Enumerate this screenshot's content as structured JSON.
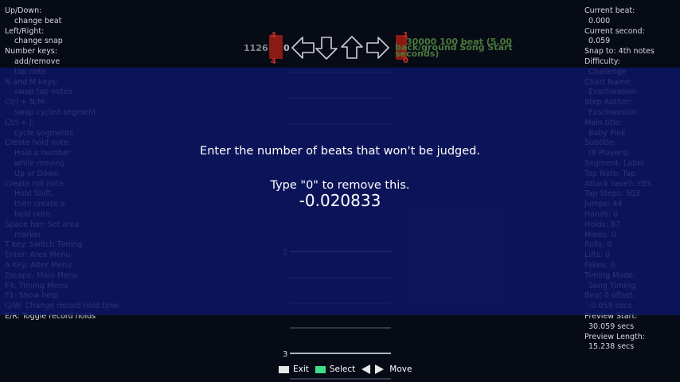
{
  "help": [
    {
      "text": "Up/Down:",
      "indent": false
    },
    {
      "text": "change beat",
      "indent": true
    },
    {
      "text": "Left/Right:",
      "indent": false
    },
    {
      "text": "change snap",
      "indent": true
    },
    {
      "text": "Number keys:",
      "indent": false
    },
    {
      "text": "add/remove",
      "indent": true
    },
    {
      "text": "tap note",
      "indent": true
    },
    {
      "text": "N and M keys:",
      "indent": false
    },
    {
      "text": "swap tap notes",
      "indent": true
    },
    {
      "text": "Ctrl + N/M:",
      "indent": false
    },
    {
      "text": "swap cycled segment",
      "indent": true
    },
    {
      "text": "Ctrl + J:",
      "indent": false
    },
    {
      "text": "cycle segments",
      "indent": true
    },
    {
      "text": "Create hold note:",
      "indent": false
    },
    {
      "text": "Hold a number",
      "indent": true
    },
    {
      "text": "while moving",
      "indent": true
    },
    {
      "text": "Up or Down",
      "indent": true
    },
    {
      "text": "Create roll note:",
      "indent": false
    },
    {
      "text": "Hold Shift,",
      "indent": true
    },
    {
      "text": "then create a",
      "indent": true
    },
    {
      "text": "hold note.",
      "indent": true
    },
    {
      "text": "Space bar: Set area",
      "indent": false
    },
    {
      "text": "marker",
      "indent": true
    },
    {
      "text": "T key: Switch Timing",
      "indent": false
    },
    {
      "text": "Enter: Area Menu",
      "indent": false
    },
    {
      "text": "A Key: Alter Menu",
      "indent": false
    },
    {
      "text": "Escape: Main Menu",
      "indent": false
    },
    {
      "text": "F4: Timing Menu",
      "indent": false
    },
    {
      "text": "F1: Show help",
      "indent": false
    },
    {
      "text": "Q/W: Change record hold time",
      "indent": false
    },
    {
      "text": "E/R: Toggle record holds",
      "indent": false
    }
  ],
  "info": [
    {
      "text": "Current beat:",
      "indent": false
    },
    {
      "text": "0.000",
      "indent": true
    },
    {
      "text": "Current second:",
      "indent": false
    },
    {
      "text": "0.059",
      "indent": true
    },
    {
      "text": "Snap to: 4th notes",
      "indent": false
    },
    {
      "text": "Difficulty:",
      "indent": false
    },
    {
      "text": "Challenge",
      "indent": true
    },
    {
      "text": "Chart Name:",
      "indent": false
    },
    {
      "text": "Exschwasion",
      "indent": true
    },
    {
      "text": "Step Author:",
      "indent": false
    },
    {
      "text": "Exschwasion",
      "indent": true
    },
    {
      "text": "Main title:",
      "indent": false
    },
    {
      "text": "Baby Pink",
      "indent": true
    },
    {
      "text": "Subtitle:",
      "indent": false
    },
    {
      "text": "(8 Players)",
      "indent": true
    },
    {
      "text": "Segment: Label",
      "indent": false
    },
    {
      "text": "Tap Note: Tap",
      "indent": false
    },
    {
      "text": "Attack here?: YES",
      "indent": false
    },
    {
      "text": "Tap Steps: 503",
      "indent": false
    },
    {
      "text": "Jumps: 44",
      "indent": false
    },
    {
      "text": "Hands: 0",
      "indent": false
    },
    {
      "text": "Holds: 87",
      "indent": false
    },
    {
      "text": "Mines: 0",
      "indent": false
    },
    {
      "text": "Rolls: 0",
      "indent": false
    },
    {
      "text": "Lifts: 0",
      "indent": false
    },
    {
      "text": "Fakes: 0",
      "indent": false
    },
    {
      "text": "Timing Mode:",
      "indent": false
    },
    {
      "text": "Song Timing",
      "indent": true
    },
    {
      "text": "Beat 0 offset:",
      "indent": false
    },
    {
      "text": "-0.059 secs",
      "indent": true
    },
    {
      "text": "Preview Start:",
      "indent": false
    },
    {
      "text": "30.059 secs",
      "indent": true
    },
    {
      "text": "Preview Length:",
      "indent": false
    },
    {
      "text": "15.238 secs",
      "indent": true
    }
  ],
  "receptor": {
    "arrows": [
      "left-arrow-icon",
      "down-arrow-icon",
      "up-arrow-icon",
      "right-arrow-icon"
    ],
    "left_number": "1126",
    "left_marker": "0",
    "bpm_value_top": "4",
    "bpm_value_bottom": "4",
    "right_top_digit": "1",
    "right_bottom_digit": "0",
    "right_label_line1": "30000 100 beat (5.00",
    "right_label_line2": "seconds)",
    "right_overlap_label": "back/ground Song Start"
  },
  "beat_markers": [
    {
      "beat": "2"
    },
    {
      "beat": "3"
    }
  ],
  "dialog": {
    "line1": "Enter the number of beats that won't be judged.",
    "line2": "Type \"0\" to remove this.",
    "value": "-0.020833"
  },
  "footer": {
    "exit_label": "Exit",
    "select_label": "Select",
    "move_label": "Move",
    "exit_color": "#e8e8e8",
    "select_color": "#3de08a"
  },
  "colors": {
    "overlay": "#0e1664",
    "background": "#060b16",
    "bpm_marker": "#8a1a14",
    "label_green": "#4a7a3a"
  }
}
